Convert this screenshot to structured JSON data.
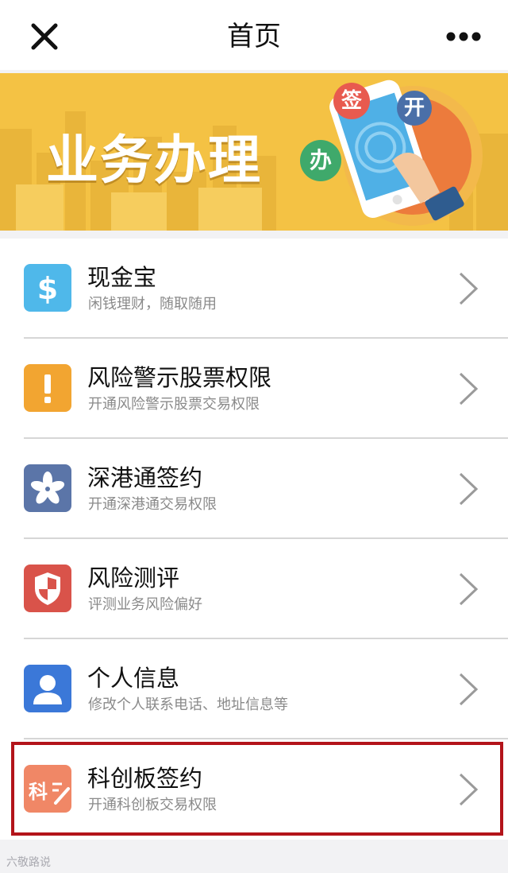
{
  "header": {
    "title": "首页",
    "close_icon": "close-icon",
    "more_icon": "more-icon"
  },
  "banner": {
    "title": "业务办理",
    "bubbles": [
      "签",
      "开",
      "办"
    ]
  },
  "list": {
    "items": [
      {
        "title": "现金宝",
        "subtitle": "闲钱理财，随取随用",
        "icon": "dollar-icon",
        "color": "#4fb8ea"
      },
      {
        "title": "风险警示股票权限",
        "subtitle": "开通风险警示股票交易权限",
        "icon": "exclamation-icon",
        "color": "#f2a531"
      },
      {
        "title": "深港通签约",
        "subtitle": "开通深港通交易权限",
        "icon": "bauhinia-icon",
        "color": "#5b75a8"
      },
      {
        "title": "风险测评",
        "subtitle": "评测业务风险偏好",
        "icon": "shield-icon",
        "color": "#d9534a"
      },
      {
        "title": "个人信息",
        "subtitle": "修改个人联系电话、地址信息等",
        "icon": "person-icon",
        "color": "#3b78d8"
      },
      {
        "title": "科创板签约",
        "subtitle": "开通科创板交易权限",
        "icon": "star-market-sign-icon",
        "color": "#f08766",
        "icon_text": "科"
      }
    ]
  },
  "watermark": "六敬路说"
}
